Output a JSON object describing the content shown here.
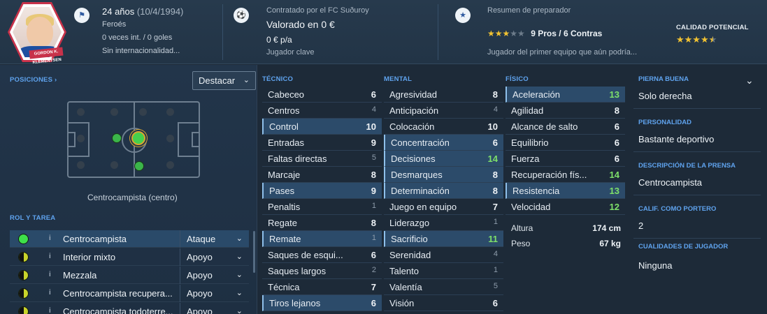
{
  "header": {
    "nametag": "GORDON K. KLEMENTSEN",
    "age": "24 años",
    "dob": "(10/4/1994)",
    "nationality": "Feroés",
    "caps": "0 veces int. / 0 goles",
    "intl_status": "Sin internacionalidad...",
    "contract": "Contratado por el FC Suðuroy",
    "value": "Valorado en 0 €",
    "wage": "0 € p/a",
    "squad_status": "Jugador clave",
    "scout_title": "Resumen de preparador",
    "scout_summary": "9 Pros / 6 Contras",
    "scout_text": "Jugador del primer equipo que aún podría...",
    "scout_stars": 3,
    "potential_label": "CALIDAD POTENCIAL",
    "potential_stars": 4.5
  },
  "positions": {
    "title": "POSICIONES",
    "dropdown": "Destacar",
    "position_name": "Centrocampista (centro)"
  },
  "roles": {
    "title": "ROL Y TAREA",
    "items": [
      {
        "name": "Centrocampista",
        "duty": "Ataque"
      },
      {
        "name": "Interior mixto",
        "duty": "Apoyo"
      },
      {
        "name": "Mezzala",
        "duty": "Apoyo"
      },
      {
        "name": "Centrocampista recupera...",
        "duty": "Apoyo"
      },
      {
        "name": "Centrocampista todoterre...",
        "duty": "Apoyo"
      }
    ]
  },
  "technical": {
    "title": "TÉCNICO",
    "attrs": [
      {
        "n": "Cabeceo",
        "v": "6"
      },
      {
        "n": "Centros",
        "v": "4"
      },
      {
        "n": "Control",
        "v": "10"
      },
      {
        "n": "Entradas",
        "v": "9"
      },
      {
        "n": "Faltas directas",
        "v": "5"
      },
      {
        "n": "Marcaje",
        "v": "8"
      },
      {
        "n": "Pases",
        "v": "9"
      },
      {
        "n": "Penaltis",
        "v": "1"
      },
      {
        "n": "Regate",
        "v": "8"
      },
      {
        "n": "Remate",
        "v": "1"
      },
      {
        "n": "Saques de esqui...",
        "v": "6"
      },
      {
        "n": "Saques largos",
        "v": "2"
      },
      {
        "n": "Técnica",
        "v": "7"
      },
      {
        "n": "Tiros lejanos",
        "v": "6"
      }
    ]
  },
  "mental": {
    "title": "MENTAL",
    "attrs": [
      {
        "n": "Agresividad",
        "v": "8"
      },
      {
        "n": "Anticipación",
        "v": "4"
      },
      {
        "n": "Colocación",
        "v": "10"
      },
      {
        "n": "Concentración",
        "v": "6"
      },
      {
        "n": "Decisiones",
        "v": "14"
      },
      {
        "n": "Desmarques",
        "v": "8"
      },
      {
        "n": "Determinación",
        "v": "8"
      },
      {
        "n": "Juego en equipo",
        "v": "7"
      },
      {
        "n": "Liderazgo",
        "v": "1"
      },
      {
        "n": "Sacrificio",
        "v": "11"
      },
      {
        "n": "Serenidad",
        "v": "4"
      },
      {
        "n": "Talento",
        "v": "1"
      },
      {
        "n": "Valentía",
        "v": "5"
      },
      {
        "n": "Visión",
        "v": "6"
      }
    ]
  },
  "physical": {
    "title": "FÍSICO",
    "attrs": [
      {
        "n": "Aceleración",
        "v": "13"
      },
      {
        "n": "Agilidad",
        "v": "8"
      },
      {
        "n": "Alcance de salto",
        "v": "6"
      },
      {
        "n": "Equilibrio",
        "v": "6"
      },
      {
        "n": "Fuerza",
        "v": "6"
      },
      {
        "n": "Recuperación fís...",
        "v": "14"
      },
      {
        "n": "Resistencia",
        "v": "13"
      },
      {
        "n": "Velocidad",
        "v": "12"
      }
    ],
    "height_label": "Altura",
    "height": "174 cm",
    "weight_label": "Peso",
    "weight": "67 kg"
  },
  "right": {
    "foot_label": "PIERNA BUENA",
    "foot": "Solo derecha",
    "personality_label": "PERSONALIDAD",
    "personality": "Bastante deportivo",
    "media_label": "DESCRIPCIÓN DE LA PRENSA",
    "media": "Centrocampista",
    "gk_label": "CALIF. COMO PORTERO",
    "gk": "2",
    "traits_label": "CUALIDADES DE JUGADOR",
    "traits": "Ninguna"
  },
  "colors": {
    "accent": "#5fa3ee",
    "high": "#7ee06a",
    "star": "#f1c232"
  }
}
